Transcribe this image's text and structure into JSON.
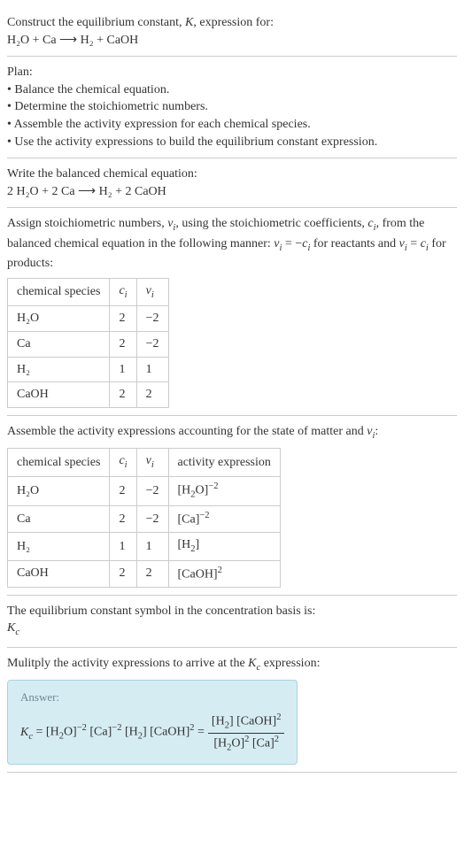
{
  "intro": {
    "line1": "Construct the equilibrium constant, K, expression for:",
    "equation": "H₂O + Ca ⟶ H₂ + CaOH"
  },
  "plan": {
    "heading": "Plan:",
    "items": [
      "Balance the chemical equation.",
      "Determine the stoichiometric numbers.",
      "Assemble the activity expression for each chemical species.",
      "Use the activity expressions to build the equilibrium constant expression."
    ]
  },
  "balanced": {
    "heading": "Write the balanced chemical equation:",
    "equation": "2 H₂O + 2 Ca ⟶ H₂ + 2 CaOH"
  },
  "stoich": {
    "text": "Assign stoichiometric numbers, νᵢ, using the stoichiometric coefficients, cᵢ, from the balanced chemical equation in the following manner: νᵢ = −cᵢ for reactants and νᵢ = cᵢ for products:",
    "headers": [
      "chemical species",
      "cᵢ",
      "νᵢ"
    ],
    "rows": [
      {
        "species": "H₂O",
        "c": "2",
        "v": "−2"
      },
      {
        "species": "Ca",
        "c": "2",
        "v": "−2"
      },
      {
        "species": "H₂",
        "c": "1",
        "v": "1"
      },
      {
        "species": "CaOH",
        "c": "2",
        "v": "2"
      }
    ]
  },
  "activity": {
    "text": "Assemble the activity expressions accounting for the state of matter and νᵢ:",
    "headers": [
      "chemical species",
      "cᵢ",
      "νᵢ",
      "activity expression"
    ],
    "rows": [
      {
        "species": "H₂O",
        "c": "2",
        "v": "−2",
        "expr": "[H₂O]⁻²"
      },
      {
        "species": "Ca",
        "c": "2",
        "v": "−2",
        "expr": "[Ca]⁻²"
      },
      {
        "species": "H₂",
        "c": "1",
        "v": "1",
        "expr": "[H₂]"
      },
      {
        "species": "CaOH",
        "c": "2",
        "v": "2",
        "expr": "[CaOH]²"
      }
    ]
  },
  "symbol": {
    "text": "The equilibrium constant symbol in the concentration basis is:",
    "value": "K𝒸"
  },
  "multiply": {
    "text": "Mulitply the activity expressions to arrive at the K𝒸 expression:"
  },
  "answer": {
    "label": "Answer:",
    "lhs": "K𝒸 = [H₂O]⁻² [Ca]⁻² [H₂] [CaOH]² =",
    "num": "[H₂] [CaOH]²",
    "den": "[H₂O]² [Ca]²"
  }
}
